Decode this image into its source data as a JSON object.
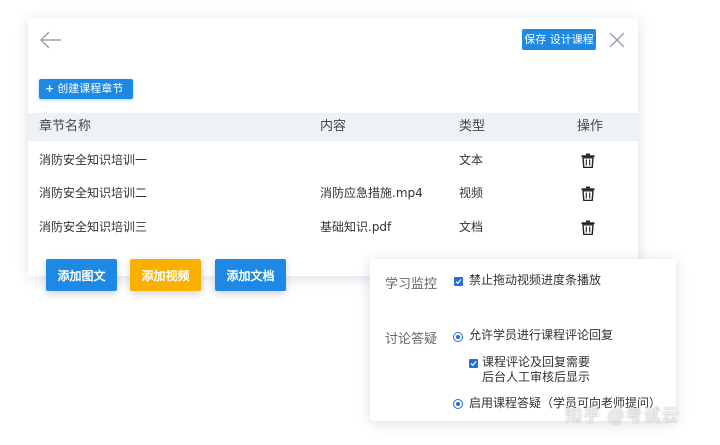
{
  "toolbar": {
    "save_label": "保存 设计课程",
    "create_chapter_label": "创建课程章节",
    "create_chapter_icon": "plus-icon"
  },
  "table": {
    "headers": [
      "章节名称",
      "内容",
      "类型",
      "操作"
    ],
    "rows": [
      {
        "name": "消防安全知识培训一",
        "content": "",
        "type": "文本"
      },
      {
        "name": "消防安全知识培训二",
        "content": "消防应急措施.mp4",
        "type": "视频"
      },
      {
        "name": "消防安全知识培训三",
        "content": "基础知识.pdf",
        "type": "文档"
      }
    ],
    "row_action_icon": "trash-icon"
  },
  "actions": {
    "add_text": "添加图文",
    "add_video": "添加视频",
    "add_doc": "添加文档"
  },
  "settings": {
    "monitor_label": "学习监控",
    "monitor_option": "禁止拖动视频进度条播放",
    "monitor_checked": true,
    "discussion_label": "讨论答疑",
    "allow_comment": "允许学员进行课程评论回复",
    "review_line1": "课程评论及回复需要",
    "review_line2": "后台人工审核后显示",
    "review_checked": true,
    "enable_qa": "启用课程答疑（学员可向老师提问）"
  },
  "watermark": "知乎 @考试云",
  "colors": {
    "primary": "#1e88e5",
    "accent": "#fbb000",
    "header_bg": "#eef2f6"
  }
}
